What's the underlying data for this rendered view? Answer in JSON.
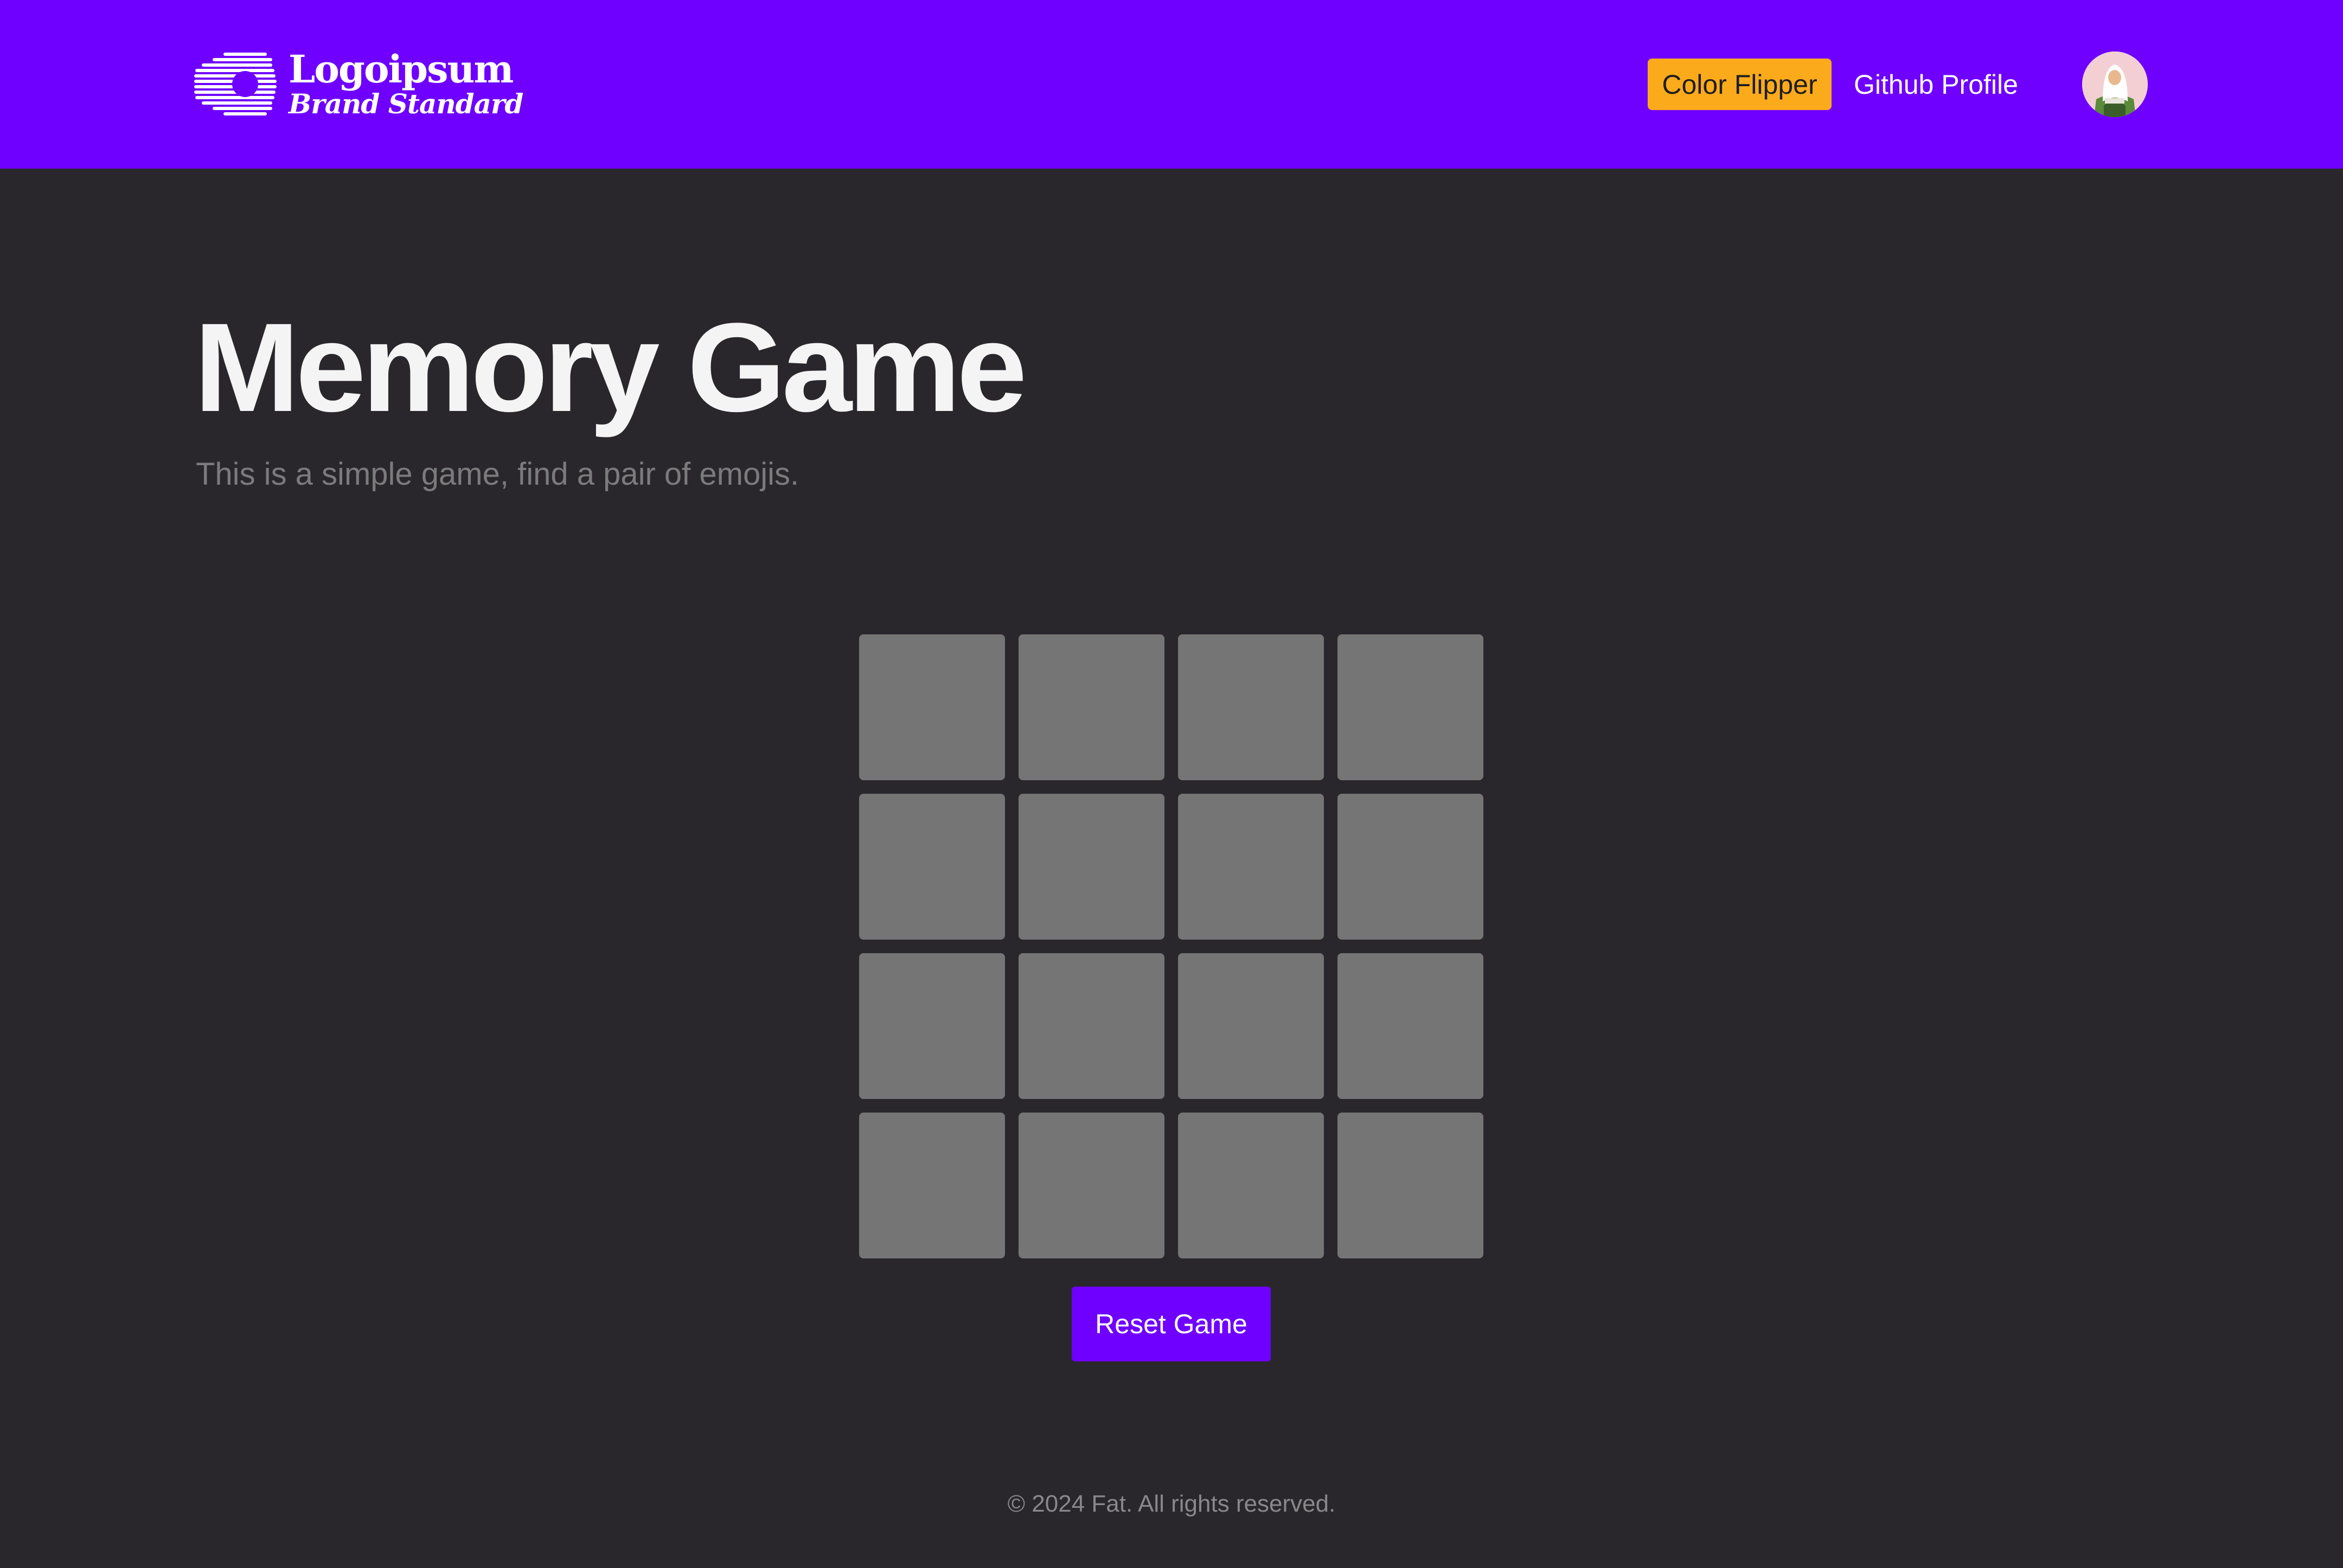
{
  "header": {
    "logo": {
      "name": "Logoipsum",
      "tagline": "Brand Standard"
    },
    "nav": {
      "color_flipper_label": "Color Flipper",
      "github_label": "Github Profile"
    },
    "avatar_icon": "user-avatar"
  },
  "main": {
    "title": "Memory Game",
    "subtitle": "This is a simple game, find a pair of emojis.",
    "board": {
      "rows": 4,
      "columns": 4,
      "cards_face_down": 16
    },
    "reset_label": "Reset Game"
  },
  "footer": {
    "text": "© 2024 Fat. All rights reserved."
  },
  "colors": {
    "brand": "#6f00ff",
    "accent": "#fbaa1c",
    "background": "#29272b",
    "card": "#757575"
  }
}
